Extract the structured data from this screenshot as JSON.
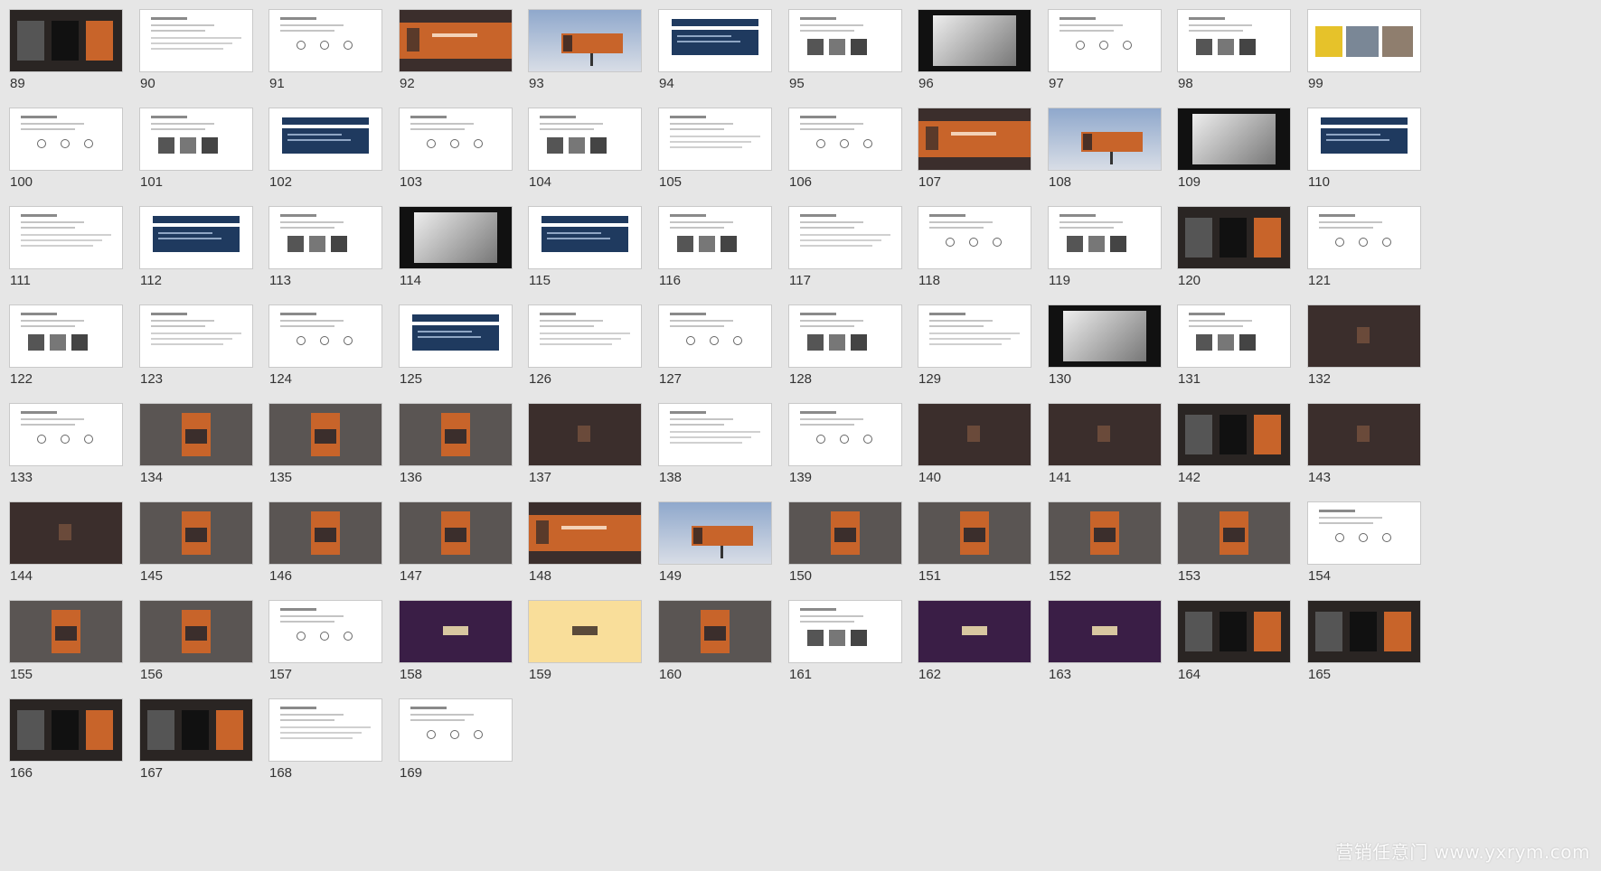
{
  "window": {
    "view": "slide-sorter"
  },
  "slides": [
    {
      "number": "89",
      "theme": "dark"
    },
    {
      "number": "90",
      "theme": "white"
    },
    {
      "number": "91",
      "theme": "white"
    },
    {
      "number": "92",
      "theme": "orange"
    },
    {
      "number": "93",
      "theme": "sky"
    },
    {
      "number": "94",
      "theme": "navy"
    },
    {
      "number": "95",
      "theme": "white"
    },
    {
      "number": "96",
      "theme": "black"
    },
    {
      "number": "97",
      "theme": "white"
    },
    {
      "number": "98",
      "theme": "white"
    },
    {
      "number": "99",
      "theme": "photo"
    },
    {
      "number": "100",
      "theme": "white"
    },
    {
      "number": "101",
      "theme": "white"
    },
    {
      "number": "102",
      "theme": "navy"
    },
    {
      "number": "103",
      "theme": "white"
    },
    {
      "number": "104",
      "theme": "white"
    },
    {
      "number": "105",
      "theme": "white"
    },
    {
      "number": "106",
      "theme": "white"
    },
    {
      "number": "107",
      "theme": "orange"
    },
    {
      "number": "108",
      "theme": "sky"
    },
    {
      "number": "109",
      "theme": "black"
    },
    {
      "number": "110",
      "theme": "navy"
    },
    {
      "number": "111",
      "theme": "white"
    },
    {
      "number": "112",
      "theme": "navy"
    },
    {
      "number": "113",
      "theme": "white"
    },
    {
      "number": "114",
      "theme": "black"
    },
    {
      "number": "115",
      "theme": "navy"
    },
    {
      "number": "116",
      "theme": "white"
    },
    {
      "number": "117",
      "theme": "white"
    },
    {
      "number": "118",
      "theme": "white"
    },
    {
      "number": "119",
      "theme": "white"
    },
    {
      "number": "120",
      "theme": "dark"
    },
    {
      "number": "121",
      "theme": "white"
    },
    {
      "number": "122",
      "theme": "white"
    },
    {
      "number": "123",
      "theme": "white"
    },
    {
      "number": "124",
      "theme": "white"
    },
    {
      "number": "125",
      "theme": "navy"
    },
    {
      "number": "126",
      "theme": "white"
    },
    {
      "number": "127",
      "theme": "white"
    },
    {
      "number": "128",
      "theme": "white"
    },
    {
      "number": "129",
      "theme": "white"
    },
    {
      "number": "130",
      "theme": "black"
    },
    {
      "number": "131",
      "theme": "white"
    },
    {
      "number": "132",
      "theme": "brown"
    },
    {
      "number": "133",
      "theme": "white"
    },
    {
      "number": "134",
      "theme": "gray"
    },
    {
      "number": "135",
      "theme": "gray"
    },
    {
      "number": "136",
      "theme": "gray"
    },
    {
      "number": "137",
      "theme": "brown"
    },
    {
      "number": "138",
      "theme": "white"
    },
    {
      "number": "139",
      "theme": "white"
    },
    {
      "number": "140",
      "theme": "brown"
    },
    {
      "number": "141",
      "theme": "brown"
    },
    {
      "number": "142",
      "theme": "dark"
    },
    {
      "number": "143",
      "theme": "brown"
    },
    {
      "number": "144",
      "theme": "brown"
    },
    {
      "number": "145",
      "theme": "gray"
    },
    {
      "number": "146",
      "theme": "gray"
    },
    {
      "number": "147",
      "theme": "gray"
    },
    {
      "number": "148",
      "theme": "orange"
    },
    {
      "number": "149",
      "theme": "sky"
    },
    {
      "number": "150",
      "theme": "gray"
    },
    {
      "number": "151",
      "theme": "gray"
    },
    {
      "number": "152",
      "theme": "gray"
    },
    {
      "number": "153",
      "theme": "gray"
    },
    {
      "number": "154",
      "theme": "white"
    },
    {
      "number": "155",
      "theme": "gray"
    },
    {
      "number": "156",
      "theme": "gray"
    },
    {
      "number": "157",
      "theme": "white"
    },
    {
      "number": "158",
      "theme": "purple"
    },
    {
      "number": "159",
      "theme": "yellow"
    },
    {
      "number": "160",
      "theme": "gray"
    },
    {
      "number": "161",
      "theme": "white"
    },
    {
      "number": "162",
      "theme": "purple"
    },
    {
      "number": "163",
      "theme": "purple"
    },
    {
      "number": "164",
      "theme": "dark"
    },
    {
      "number": "165",
      "theme": "dark"
    },
    {
      "number": "166",
      "theme": "dark"
    },
    {
      "number": "167",
      "theme": "dark"
    },
    {
      "number": "168",
      "theme": "white"
    },
    {
      "number": "169",
      "theme": "white"
    }
  ],
  "colors": {
    "background": "#e6e6e6",
    "navy": "#1f3a5f",
    "orange": "#c8642a",
    "brown": "#3b2e2c",
    "gray": "#5a5553",
    "purple": "#3a1e46",
    "yellow": "#f9de9a",
    "sky": "#a9bcd6"
  },
  "watermark": "营销任意门 www.yxrym.com"
}
